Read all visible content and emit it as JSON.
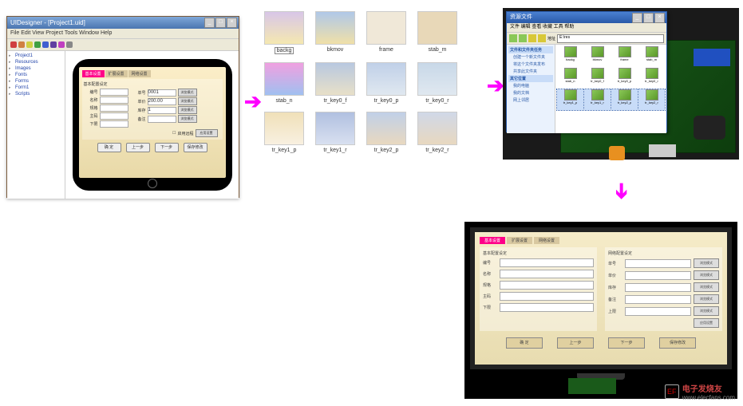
{
  "ide": {
    "title": "UIDesigner - [Project1.uid]",
    "menu": "File  Edit  View  Project  Tools  Window  Help",
    "toolbar_colors": [
      "#d04040",
      "#d08040",
      "#d0d040",
      "#40a040",
      "#4060d0",
      "#6040a0",
      "#c040c0",
      "#888"
    ],
    "tree": [
      "Project1",
      "Resources",
      "Images",
      "Fonts",
      "Forms",
      "Form1",
      "Scripts"
    ],
    "tablet_tabs": [
      "基本设置",
      "扩展设置",
      "网络设置"
    ],
    "section_title": "基本配置设定",
    "form_left_labels": [
      "编号",
      "名称",
      "规格",
      "主码",
      "下限"
    ],
    "form_right_labels": [
      "单号",
      "单价",
      "库存",
      "备注"
    ],
    "form_right_values": [
      "0001",
      "200.00",
      "1",
      "",
      ""
    ],
    "browse_btn": "浏览模式",
    "check_option": "启用远程",
    "apply_btn": "应用设置",
    "bottom_buttons": [
      "确 定",
      "上一步",
      "下一步",
      "保存修改"
    ]
  },
  "thumbs": [
    [
      {
        "name": "backg",
        "boxed": true,
        "grad": [
          "#d8c6e8",
          "#f5e8b0"
        ]
      },
      {
        "name": "bkmov",
        "grad": [
          "#b0c8e8",
          "#f0e0a8"
        ]
      },
      {
        "name": "frame",
        "grad": [
          "#f0e8d8",
          "#f0e8d8"
        ]
      },
      {
        "name": "stab_m",
        "grad": [
          "#e8d8b8",
          "#e8d8b8"
        ]
      }
    ],
    [
      {
        "name": "stab_n",
        "grad": [
          "#f0a0e0",
          "#a0c0f0"
        ]
      },
      {
        "name": "tr_key0_f",
        "grad": [
          "#b8c8e0",
          "#e8e0c8"
        ]
      },
      {
        "name": "tr_key0_p",
        "grad": [
          "#c0d0e8",
          "#e0e8f0"
        ]
      },
      {
        "name": "tr_key0_r",
        "grad": [
          "#c8d8e8",
          "#e0e8f0"
        ]
      }
    ],
    [
      {
        "name": "tr_key1_p",
        "grad": [
          "#f0e0b8",
          "#f8f0e0"
        ]
      },
      {
        "name": "tr_key1_r",
        "grad": [
          "#b0c0e0",
          "#d8e0f0"
        ]
      },
      {
        "name": "tr_key2_p",
        "grad": [
          "#c0d0e8",
          "#e8d8c0"
        ]
      },
      {
        "name": "tr_key2_r",
        "grad": [
          "#d0d8e8",
          "#e8d8c0"
        ]
      }
    ]
  ],
  "explorer": {
    "title": "资源文件",
    "menu": "文件  编辑  查看  收藏  工具  帮助",
    "address_label": "地址",
    "address": "E:\\res",
    "side_head": "文件和文件夹任务",
    "side_items": [
      "创建一个新文件夹",
      "将这个文件夹发布",
      "共享此文件夹"
    ],
    "side_head2": "其它位置",
    "side_items2": [
      "我的电脑",
      "我的文档",
      "网上邻居"
    ],
    "files": [
      "backg",
      "bkmov",
      "frame",
      "stab_m",
      "stab_n",
      "tr_key0_f",
      "tr_key0_p",
      "tr_key0_r",
      "tr_key1_p",
      "tr_key1_r",
      "tr_key2_p",
      "tr_key2_r"
    ]
  },
  "tv": {
    "tabs": [
      "基本设置",
      "扩展设置",
      "网络设置"
    ],
    "left_head": "基本配置设定",
    "right_head": "网络配置设定",
    "left_labels": [
      "编号",
      "名称",
      "规格",
      "主码",
      "下限"
    ],
    "right_labels": [
      "单号",
      "单价",
      "库存",
      "备注",
      "上限"
    ],
    "browse": "浏览模式",
    "apply": "应用设置",
    "bottom": [
      "确 定",
      "上一步",
      "下一步",
      "保存修改"
    ]
  },
  "watermark": {
    "brand": "电子发烧友",
    "url": "www.elecfans.com",
    "logo": "EF"
  }
}
